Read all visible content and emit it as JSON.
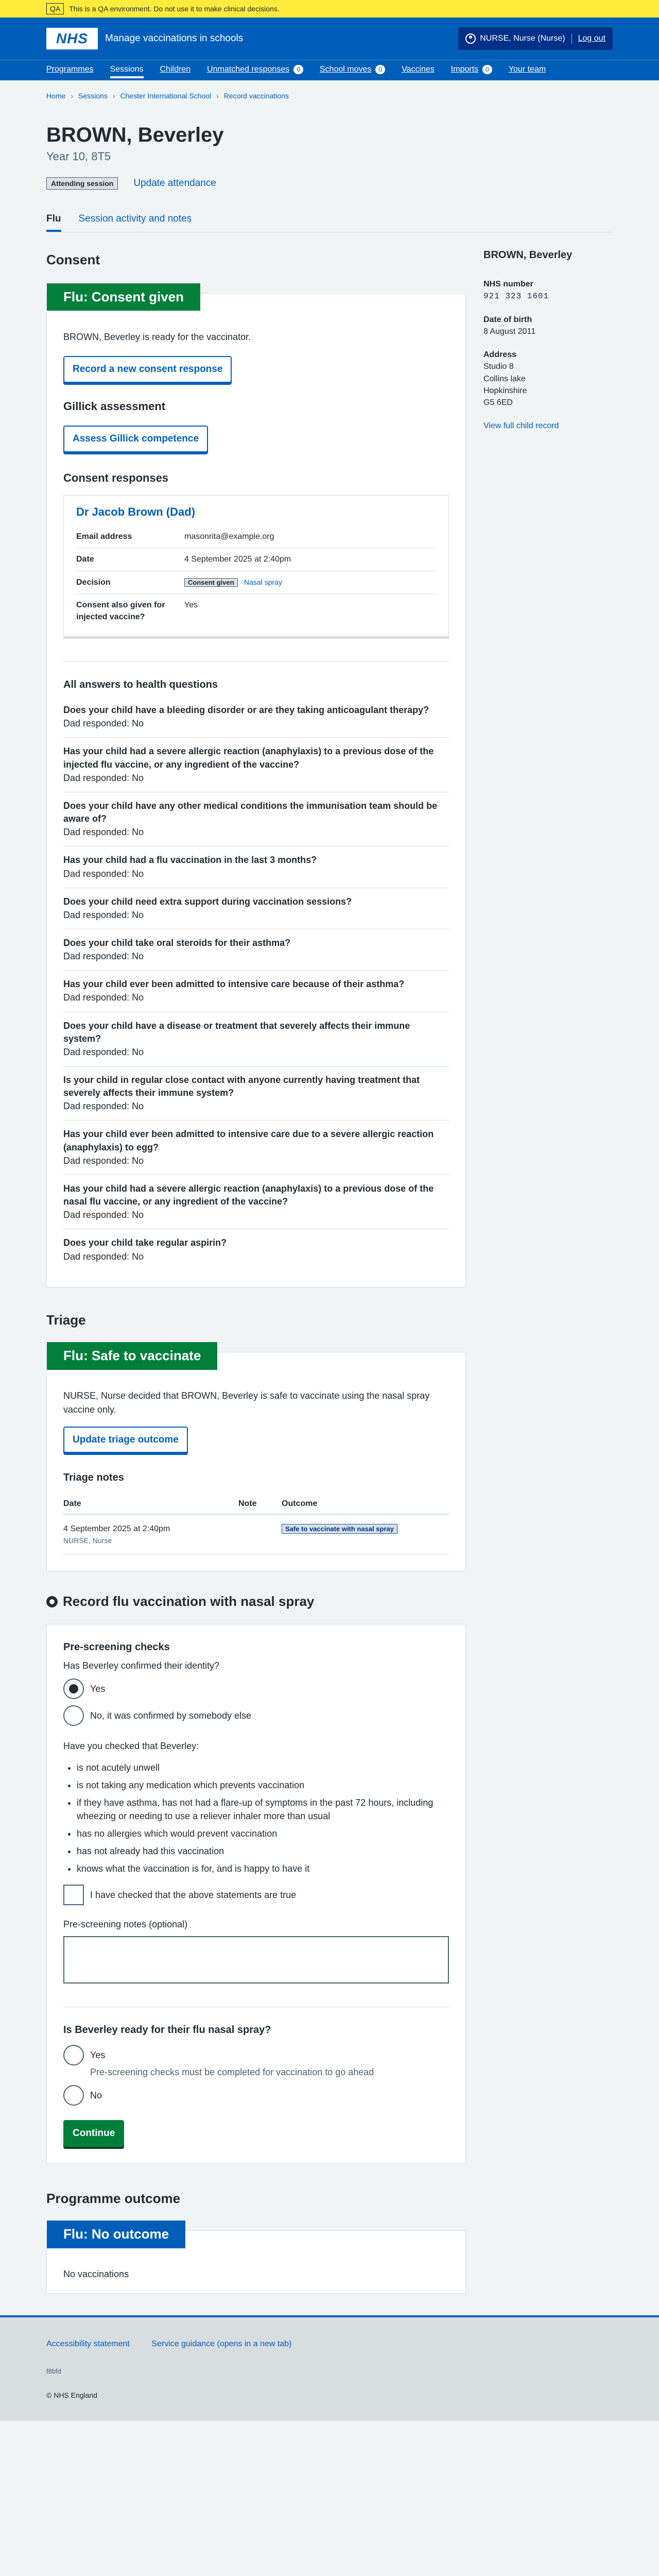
{
  "qa_banner": {
    "tag": "QA",
    "text": "This is a QA environment. Do not use it to make clinical decisions."
  },
  "header": {
    "logo": "NHS",
    "service": "Manage vaccinations in schools",
    "user": "NURSE, Nurse (Nurse)",
    "logout": "Log out"
  },
  "nav": [
    {
      "label": "Programmes"
    },
    {
      "label": "Sessions"
    },
    {
      "label": "Children"
    },
    {
      "label": "Unmatched responses",
      "count": "0"
    },
    {
      "label": "School moves",
      "count": "0"
    },
    {
      "label": "Vaccines"
    },
    {
      "label": "Imports",
      "count": "0"
    },
    {
      "label": "Your team"
    }
  ],
  "breadcrumb": [
    "Home",
    "Sessions",
    "Chester International School",
    "Record vaccinations"
  ],
  "patient": {
    "name": "BROWN, Beverley",
    "year": "Year 10, 8T5",
    "attendance_tag": "Attending session",
    "update_attendance": "Update attendance"
  },
  "tabs": [
    "Flu",
    "Session activity and notes"
  ],
  "consent": {
    "section_title": "Consent",
    "card_heading": "Flu: Consent given",
    "ready_text": "BROWN, Beverley is ready for the vaccinator.",
    "record_button": "Record a new consent response",
    "gillick_title": "Gillick assessment",
    "gillick_button": "Assess Gillick competence",
    "responses_title": "Consent responses",
    "response": {
      "parent": "Dr Jacob Brown (Dad)",
      "email_key": "Email address",
      "email_val": "masonrita@example.org",
      "date_key": "Date",
      "date_val": "4 September 2025 at 2:40pm",
      "decision_key": "Decision",
      "decision_tag": "Consent given",
      "decision_method": "Nasal spray",
      "injected_key": "Consent also given for injected vaccine?",
      "injected_val": "Yes"
    },
    "health_title": "All answers to health questions",
    "health": [
      {
        "q": "Does your child have a bleeding disorder or are they taking anticoagulant therapy?",
        "a": "Dad responded: No"
      },
      {
        "q": "Has your child had a severe allergic reaction (anaphylaxis) to a previous dose of the injected flu vaccine, or any ingredient of the vaccine?",
        "a": "Dad responded: No"
      },
      {
        "q": "Does your child have any other medical conditions the immunisation team should be aware of?",
        "a": "Dad responded: No"
      },
      {
        "q": "Has your child had a flu vaccination in the last 3 months?",
        "a": "Dad responded: No"
      },
      {
        "q": "Does your child need extra support during vaccination sessions?",
        "a": "Dad responded: No"
      },
      {
        "q": "Does your child take oral steroids for their asthma?",
        "a": "Dad responded: No"
      },
      {
        "q": "Has your child ever been admitted to intensive care because of their asthma?",
        "a": "Dad responded: No"
      },
      {
        "q": "Does your child have a disease or treatment that severely affects their immune system?",
        "a": "Dad responded: No"
      },
      {
        "q": "Is your child in regular close contact with anyone currently having treatment that severely affects their immune system?",
        "a": "Dad responded: No"
      },
      {
        "q": "Has your child ever been admitted to intensive care due to a severe allergic reaction (anaphylaxis) to egg?",
        "a": "Dad responded: No"
      },
      {
        "q": "Has your child had a severe allergic reaction (anaphylaxis) to a previous dose of the nasal flu vaccine, or any ingredient of the vaccine?",
        "a": "Dad responded: No"
      },
      {
        "q": "Does your child take regular aspirin?",
        "a": "Dad responded: No"
      }
    ]
  },
  "triage": {
    "section_title": "Triage",
    "card_heading": "Flu: Safe to vaccinate",
    "text": "NURSE, Nurse decided that BROWN, Beverley is safe to vaccinate using the nasal spray vaccine only.",
    "button": "Update triage outcome",
    "notes_title": "Triage notes",
    "columns": [
      "Date",
      "Note",
      "Outcome"
    ],
    "row": {
      "date": "4 September 2025 at 2:40pm",
      "by": "NURSE, Nurse",
      "outcome": "Safe to vaccinate with nasal spray"
    }
  },
  "record": {
    "heading": "Record flu vaccination with nasal spray",
    "prescreen_title": "Pre-screening checks",
    "identity_question": "Has Beverley confirmed their identity?",
    "identity_yes": "Yes",
    "identity_no": "No, it was confirmed by somebody else",
    "checked_intro": "Have you checked that Beverley:",
    "checks": [
      "is not acutely unwell",
      "is not taking any medication which prevents vaccination",
      "if they have asthma, has not had a flare-up of symptoms in the past 72 hours, including wheezing or needing to use a reliever inhaler more than usual",
      "has no allergies which would prevent vaccination",
      "has not already had this vaccination",
      "knows what the vaccination is for, and is happy to have it"
    ],
    "checkbox_label": "I have checked that the above statements are true",
    "notes_label": "Pre-screening notes (optional)",
    "ready_question": "Is Beverley ready for their flu nasal spray?",
    "ready_yes": "Yes",
    "ready_hint": "Pre-screening checks must be completed for vaccination to go ahead",
    "ready_no": "No",
    "continue": "Continue"
  },
  "outcome": {
    "section_title": "Programme outcome",
    "card_heading": "Flu: No outcome",
    "text": "No vaccinations"
  },
  "sidebar": {
    "name": "BROWN, Beverley",
    "nhs_label": "NHS number",
    "nhs_value": "921 323 1601",
    "dob_label": "Date of birth",
    "dob_value": "8 August 2011",
    "address_label": "Address",
    "address_lines": [
      "Studio 8",
      "Collins lake",
      "Hopkinshire",
      "G5 6ED"
    ],
    "full_record": "View full child record"
  },
  "footer": {
    "links": [
      "Accessibility statement",
      "Service guidance (opens in a new tab)"
    ],
    "small": "f8bfd",
    "copyright": "© NHS England"
  },
  "colors": {
    "nhs_blue": "#005eb8",
    "green": "#007f3b",
    "qa_yellow": "#ffeb3b"
  }
}
